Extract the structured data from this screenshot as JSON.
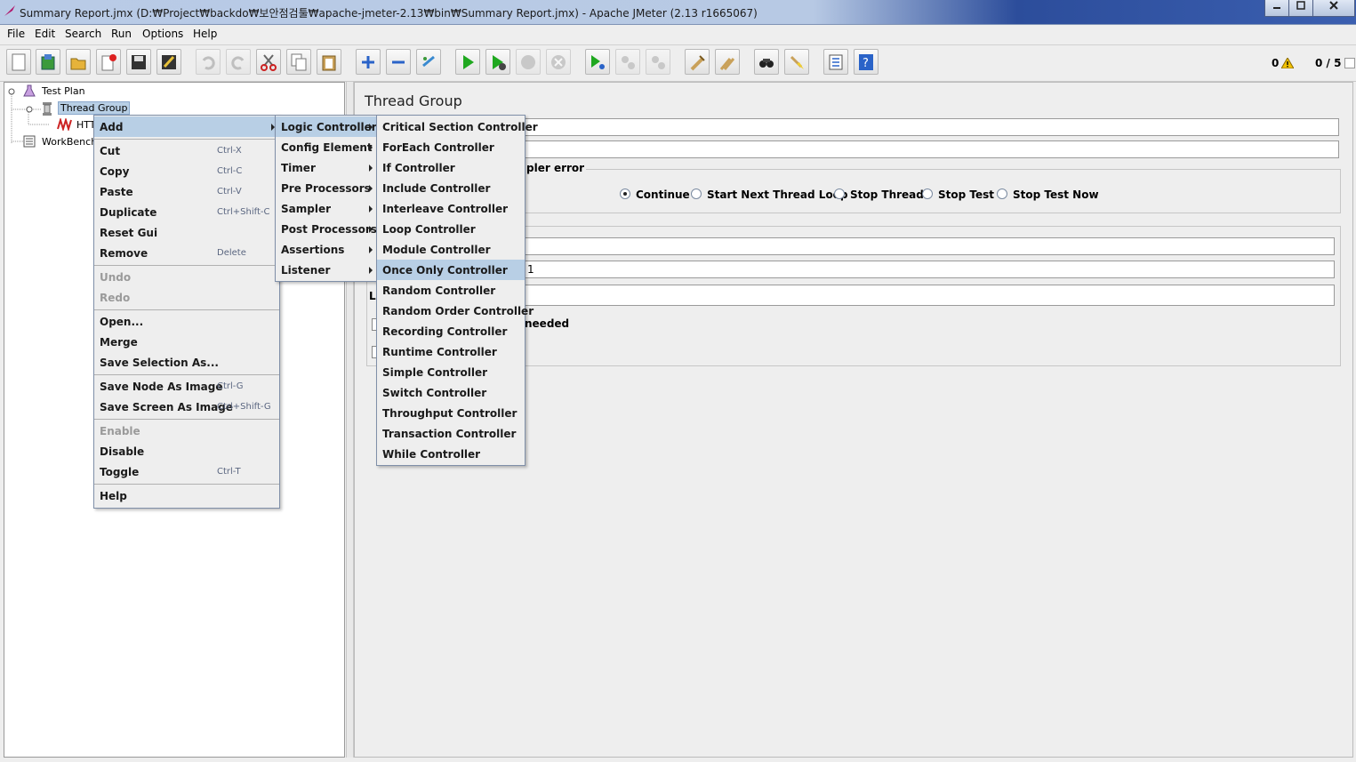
{
  "window": {
    "title": "Summary Report.jmx (D:₩Project₩backdo₩보안점검툴₩apache-jmeter-2.13₩bin₩Summary Report.jmx) - Apache JMeter (2.13 r1665067)",
    "controls": [
      "minimize",
      "maximize",
      "close"
    ]
  },
  "menubar": [
    "File",
    "Edit",
    "Search",
    "Run",
    "Options",
    "Help"
  ],
  "toolbar": {
    "icons": [
      "new-icon",
      "templates-icon",
      "open-icon",
      "close-icon",
      "save-icon",
      "save-as-icon",
      "undo-icon",
      "redo-icon",
      "cut-icon",
      "copy-icon",
      "paste-icon",
      "expand-icon",
      "collapse-icon",
      "toggle-icon",
      "start-icon",
      "start-no-pause-icon",
      "stop-icon",
      "shutdown-icon",
      "remote-start-icon",
      "remote-stop-icon",
      "remote-shutdown-icon",
      "clear-icon",
      "clear-all-icon",
      "search-icon",
      "reset-search-icon",
      "function-helper-icon",
      "help-icon"
    ],
    "error_count": "0",
    "thread_count": "0 / 5"
  },
  "tree": {
    "nodes": [
      {
        "label": "Test Plan"
      },
      {
        "label": "Thread Group"
      },
      {
        "label": "HTT"
      },
      {
        "label": "WorkBench"
      }
    ]
  },
  "main": {
    "title": "Thread Group",
    "sampler_error_label": "pler error",
    "radios": [
      {
        "label": "Continue",
        "checked": true
      },
      {
        "label": "Start Next Thread Loop",
        "checked": false
      },
      {
        "label": "Stop Thread",
        "checked": false
      },
      {
        "label": "Stop Test",
        "checked": false
      },
      {
        "label": "Stop Test Now",
        "checked": false
      }
    ],
    "field_value": "1",
    "partial_L": "L",
    "needed_text": "needed"
  },
  "context_menu": {
    "items": [
      {
        "label": "Add",
        "shortcut": ""
      },
      {
        "label": "Cut",
        "shortcut": "Ctrl-X"
      },
      {
        "label": "Copy",
        "shortcut": "Ctrl-C"
      },
      {
        "label": "Paste",
        "shortcut": "Ctrl-V"
      },
      {
        "label": "Duplicate",
        "shortcut": "Ctrl+Shift-C"
      },
      {
        "label": "Reset Gui",
        "shortcut": ""
      },
      {
        "label": "Remove",
        "shortcut": "Delete"
      },
      {
        "label": "Undo",
        "shortcut": ""
      },
      {
        "label": "Redo",
        "shortcut": ""
      },
      {
        "label": "Open...",
        "shortcut": ""
      },
      {
        "label": "Merge",
        "shortcut": ""
      },
      {
        "label": "Save Selection As...",
        "shortcut": ""
      },
      {
        "label": "Save Node As Image",
        "shortcut": "Ctrl-G"
      },
      {
        "label": "Save Screen As Image",
        "shortcut": "Ctrl+Shift-G"
      },
      {
        "label": "Enable",
        "shortcut": ""
      },
      {
        "label": "Disable",
        "shortcut": ""
      },
      {
        "label": "Toggle",
        "shortcut": "Ctrl-T"
      },
      {
        "label": "Help",
        "shortcut": ""
      }
    ]
  },
  "add_submenu": {
    "items": [
      "Logic Controller",
      "Config Element",
      "Timer",
      "Pre Processors",
      "Sampler",
      "Post Processors",
      "Assertions",
      "Listener"
    ]
  },
  "logic_submenu": {
    "items": [
      "Critical Section Controller",
      "ForEach Controller",
      "If Controller",
      "Include Controller",
      "Interleave Controller",
      "Loop Controller",
      "Module Controller",
      "Once Only Controller",
      "Random Controller",
      "Random Order Controller",
      "Recording Controller",
      "Runtime Controller",
      "Simple Controller",
      "Switch Controller",
      "Throughput Controller",
      "Transaction Controller",
      "While Controller"
    ]
  }
}
